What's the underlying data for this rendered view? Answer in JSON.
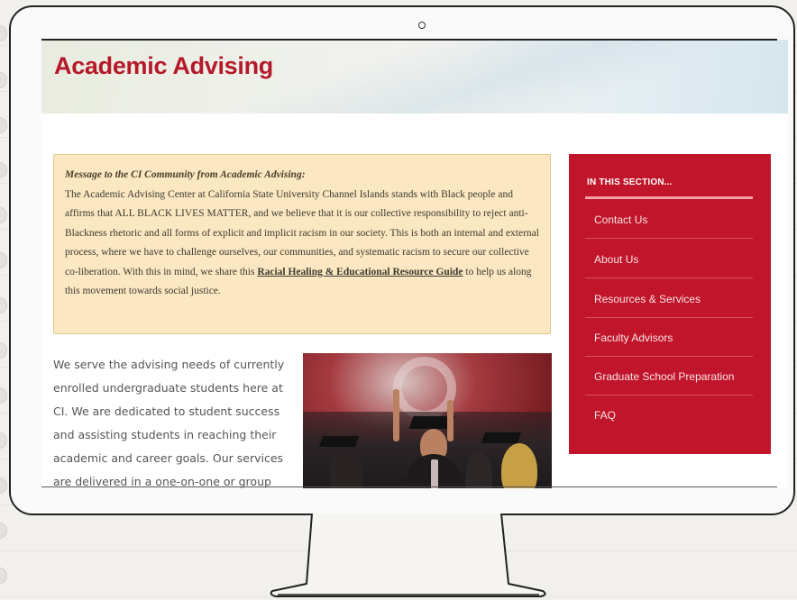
{
  "page": {
    "title": "Academic Advising"
  },
  "message": {
    "heading": "Message to the CI Community from Academic Advising:",
    "text_before_link": "The Academic Advising Center at California State University Channel Islands stands with Black people and affirms that ALL BLACK LIVES MATTER, and we believe that it is our collective responsibility to reject anti-Blackness rhetoric and all forms of explicit and implicit racism in our society. This is both an internal and external process, where we have to challenge ourselves, our communities, and systematic racism to secure our collective co-liberation. With this in mind, we share this ",
    "link_text": "Racial Healing & Educational Resource Guide",
    "text_after_link": " to help us along this movement towards social justice."
  },
  "body": {
    "intro": "We serve the advising needs of currently enrolled undergraduate students here at CI. We are dedicated to student success and assisting students in reaching their academic and career goals. Our services are delivered in a one-on-one or group"
  },
  "sidebar": {
    "heading": "IN THIS SECTION...",
    "items": [
      {
        "label": "Contact Us"
      },
      {
        "label": "About Us"
      },
      {
        "label": "Resources & Services"
      },
      {
        "label": "Faculty Advisors"
      },
      {
        "label": "Graduate School Preparation"
      },
      {
        "label": "FAQ"
      }
    ]
  },
  "colors": {
    "brand_red": "#c0152a",
    "title_red": "#b5192a",
    "notice_bg": "#fbe7c1"
  },
  "icons": {
    "camera": "camera-dot-icon"
  }
}
